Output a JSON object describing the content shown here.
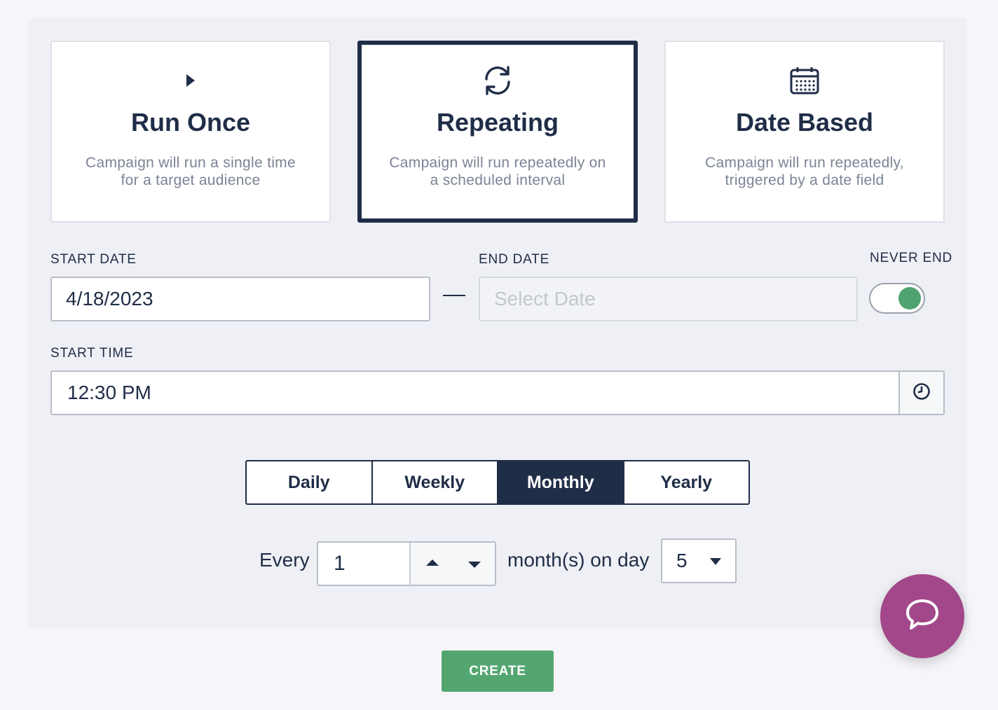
{
  "cards": [
    {
      "title": "Run Once",
      "desc_line1": "Campaign will run a single time",
      "desc_line2": "for a target audience",
      "icon": "play-icon",
      "selected": false
    },
    {
      "title": "Repeating",
      "desc_line1": "Campaign will run repeatedly on",
      "desc_line2": "a scheduled interval",
      "icon": "refresh-icon",
      "selected": true
    },
    {
      "title": "Date Based",
      "desc_line1": "Campaign will run repeatedly,",
      "desc_line2": "triggered by a date field",
      "icon": "calendar-icon",
      "selected": false
    }
  ],
  "schedule": {
    "start_date_label": "START DATE",
    "start_date_value": "4/18/2023",
    "end_date_label": "END DATE",
    "end_date_placeholder": "Select Date",
    "never_end_label": "NEVER END",
    "never_end_on": true,
    "start_time_label": "START TIME",
    "start_time_value": "12:30 PM"
  },
  "frequency": {
    "options": [
      "Daily",
      "Weekly",
      "Monthly",
      "Yearly"
    ],
    "selected": "Monthly"
  },
  "interval": {
    "every_label": "Every",
    "every_value": "1",
    "unit_label": "month(s) on day",
    "day_value": "5"
  },
  "create_label": "CREATE",
  "colors": {
    "navy": "#1f2d47",
    "green": "#54a671",
    "chat": "#a2478a"
  }
}
